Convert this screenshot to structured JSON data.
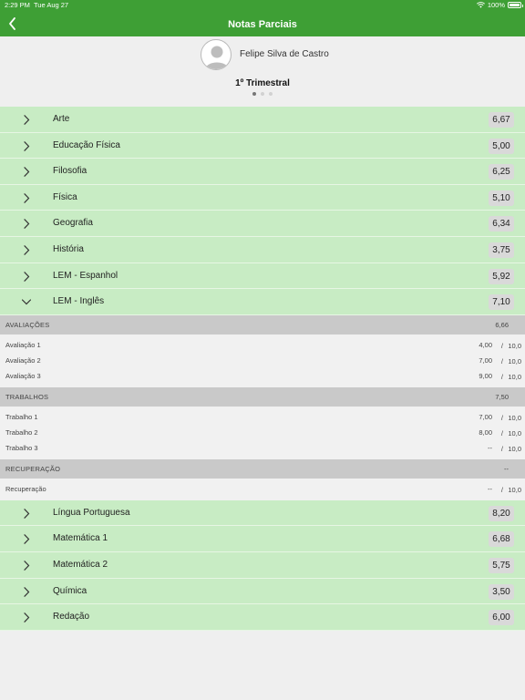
{
  "status": {
    "time": "2:29 PM",
    "date": "Tue Aug 27",
    "battery": "100%"
  },
  "header": {
    "title": "Notas Parciais"
  },
  "student": {
    "name": "Felipe Silva de Castro"
  },
  "term": {
    "title": "1º Trimestral",
    "pages": 3,
    "current_page": 1
  },
  "subjects_before": [
    {
      "label": "Arte",
      "grade": "6,67"
    },
    {
      "label": "Educação Física",
      "grade": "5,00"
    },
    {
      "label": "Filosofia",
      "grade": "6,25"
    },
    {
      "label": "Física",
      "grade": "5,10"
    },
    {
      "label": "Geografia",
      "grade": "6,34"
    },
    {
      "label": "História",
      "grade": "3,75"
    },
    {
      "label": "LEM - Espanhol",
      "grade": "5,92"
    }
  ],
  "expanded_subject": {
    "label": "LEM - Inglês",
    "grade": "7,10",
    "sections": [
      {
        "label": "AVALIAÇÕES",
        "average": "6,66",
        "items": [
          {
            "label": "Avaliação 1",
            "score": "4,00",
            "max": "10,0"
          },
          {
            "label": "Avaliação 2",
            "score": "7,00",
            "max": "10,0"
          },
          {
            "label": "Avaliação 3",
            "score": "9,00",
            "max": "10,0"
          }
        ]
      },
      {
        "label": "TRABALHOS",
        "average": "7,50",
        "items": [
          {
            "label": "Trabalho 1",
            "score": "7,00",
            "max": "10,0"
          },
          {
            "label": "Trabalho 2",
            "score": "8,00",
            "max": "10,0"
          },
          {
            "label": "Trabalho 3",
            "score": "--",
            "max": "10,0"
          }
        ]
      },
      {
        "label": "RECUPERAÇÃO",
        "average": "--",
        "items": [
          {
            "label": "Recuperação",
            "score": "--",
            "max": "10,0"
          }
        ]
      }
    ]
  },
  "subjects_after": [
    {
      "label": "Língua Portuguesa",
      "grade": "8,20"
    },
    {
      "label": "Matemática 1",
      "grade": "6,68"
    },
    {
      "label": "Matemática 2",
      "grade": "5,75"
    },
    {
      "label": "Química",
      "grade": "3,50"
    },
    {
      "label": "Redação",
      "grade": "6,00"
    }
  ],
  "colors": {
    "header_green": "#3e9f35",
    "row_green": "#c8ecc4",
    "section_gray": "#c9c9c9"
  }
}
